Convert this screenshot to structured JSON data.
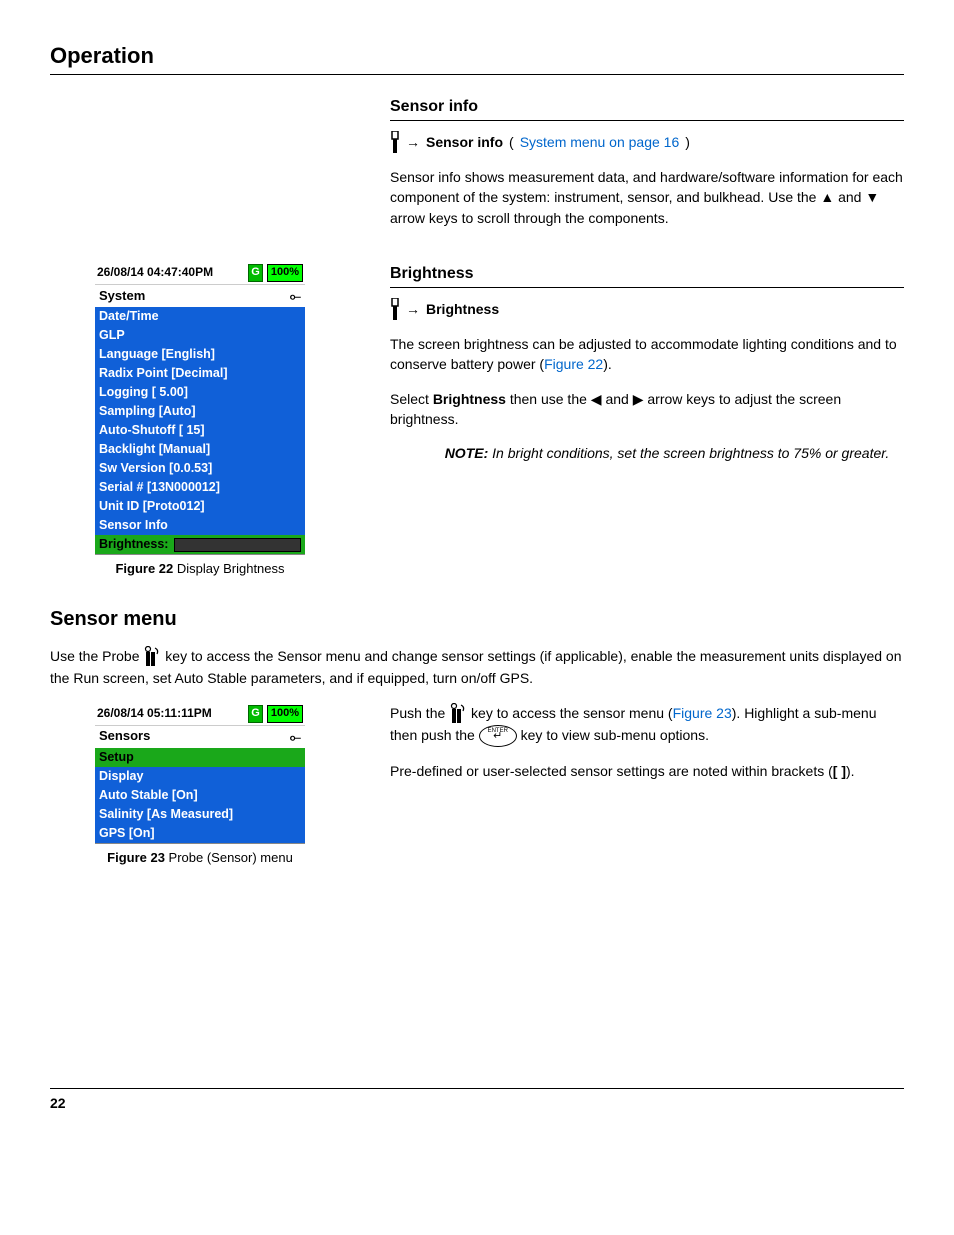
{
  "header": "Operation",
  "sensor_info": {
    "title": "Sensor info",
    "nav_arrow": "→",
    "nav_bold": "Sensor info",
    "nav_paren_open": "(",
    "nav_link": "System menu on page 16",
    "nav_paren_close": ")",
    "body_a": "Sensor info shows measurement data, and hardware/software information for each component of the system: instrument, sensor, and bulkhead. Use the ",
    "body_b": " and ",
    "body_c": " arrow keys to scroll through the components."
  },
  "brightness": {
    "title": "Brightness",
    "nav_arrow": "→",
    "nav_bold": "Brightness",
    "p1_a": "The screen brightness can be adjusted to accommodate lighting conditions and to conserve battery power (",
    "p1_link": "Figure 22",
    "p1_b": ").",
    "p2_a": "Select ",
    "p2_bold": "Brightness",
    "p2_b": " then use the ",
    "p2_c": " and ",
    "p2_d": " arrow keys to adjust the screen brightness.",
    "note_label": "NOTE:",
    "note_text": " In bright conditions, set the screen brightness to 75% or greater."
  },
  "fig22": {
    "datetime": "26/08/14 04:47:40PM",
    "gps": "G",
    "batt": "100%",
    "menu_title": "System",
    "rows": [
      "Date/Time",
      "GLP",
      "Language [English]",
      "Radix Point [Decimal]",
      "Logging [ 5.00]",
      "Sampling [Auto]",
      "Auto-Shutoff [ 15]",
      "Backlight [Manual]",
      "Sw Version [0.0.53]",
      "Serial # [13N000012]",
      "Unit ID [Proto012]",
      "Sensor Info"
    ],
    "brightness_row": "Brightness:",
    "caption_bold": "Figure 22",
    "caption_rest": "   Display Brightness"
  },
  "sensor_menu": {
    "title": "Sensor menu",
    "intro_a": "Use the Probe ",
    "intro_b": " key to access the Sensor menu and change sensor settings (if applicable), enable the measurement units displayed on the Run screen, set Auto Stable parameters, and if equipped, turn on/off GPS.",
    "p_push_a": "Push the ",
    "p_push_b": " key to access the sensor menu (",
    "p_push_link": "Figure 23",
    "p_push_c": "). Highlight a sub-menu then push the ",
    "p_push_d": " key to view sub-menu options.",
    "p2_a": "Pre-defined or user-selected sensor settings are noted within brackets (",
    "p2_bold": "[ ]",
    "p2_b": ")."
  },
  "fig23": {
    "datetime": "26/08/14 05:11:11PM",
    "gps": "G",
    "batt": "100%",
    "menu_title": "Sensors",
    "rows": [
      {
        "label": "Setup",
        "sel": true
      },
      {
        "label": "Display",
        "sel": false
      },
      {
        "label": "Auto Stable [On]",
        "sel": false
      },
      {
        "label": "Salinity [As Measured]",
        "sel": false
      },
      {
        "label": "GPS [On]",
        "sel": false
      }
    ],
    "caption_bold": "Figure 23",
    "caption_rest": "  Probe (Sensor) menu"
  },
  "enter_key_label": "ENTER",
  "page_number": "22"
}
